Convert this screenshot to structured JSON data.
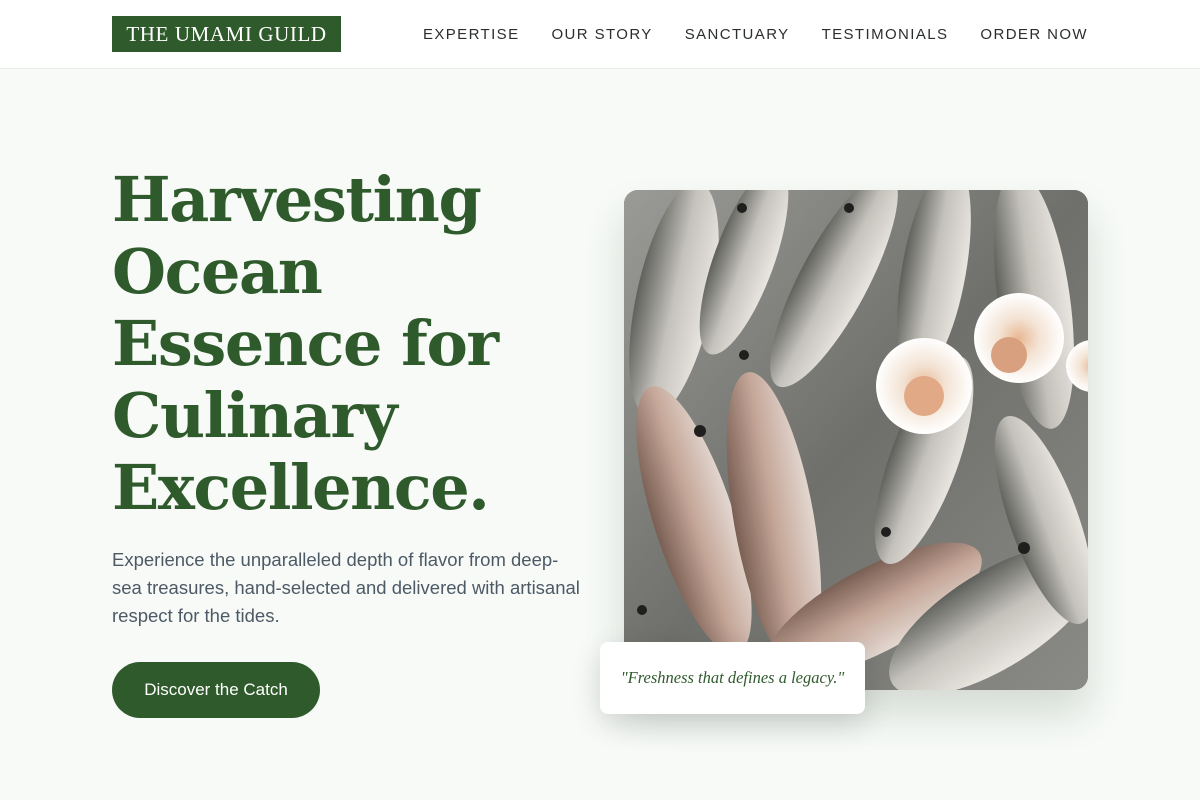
{
  "brand": {
    "logo_text": "THE UMAMI GUILD"
  },
  "nav": {
    "items": [
      "EXPERTISE",
      "OUR STORY",
      "SANCTUARY",
      "TESTIMONIALS",
      "ORDER NOW"
    ]
  },
  "hero": {
    "title_lines": [
      "Harvesting",
      "Ocean",
      "Essence for",
      "Culinary",
      "Excellence."
    ],
    "description": "Experience the unparalleled depth of flavor from deep-sea treasures, hand-selected and delivered with artisanal respect for the tides.",
    "cta_label": "Discover the Catch"
  },
  "image": {
    "subject": "fresh-fish-and-scallops-photo"
  },
  "quote": {
    "text": "\"Freshness that defines a legacy.\""
  },
  "colors": {
    "brand_green": "#2f5a2c",
    "page_background": "#f7faf7",
    "body_text": "#4d5a66"
  }
}
